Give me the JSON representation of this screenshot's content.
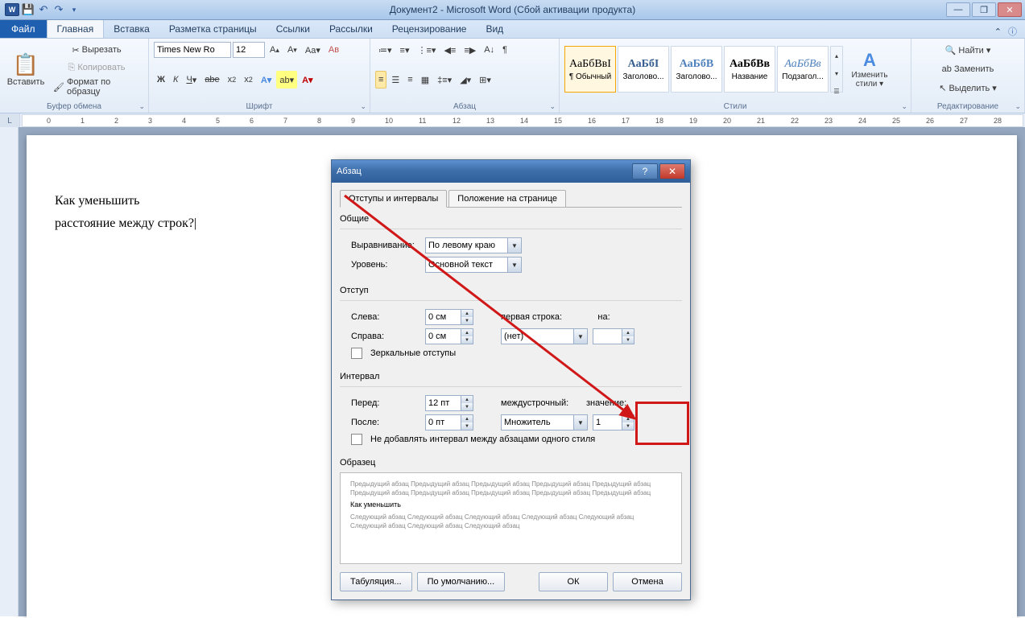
{
  "title": "Документ2 - Microsoft Word (Сбой активации продукта)",
  "tabs": {
    "file": "Файл",
    "home": "Главная",
    "insert": "Вставка",
    "layout": "Разметка страницы",
    "refs": "Ссылки",
    "mail": "Рассылки",
    "review": "Рецензирование",
    "view": "Вид"
  },
  "clipboard": {
    "paste": "Вставить",
    "cut": "Вырезать",
    "copy": "Копировать",
    "painter": "Формат по образцу",
    "label": "Буфер обмена"
  },
  "font": {
    "name": "Times New Ro",
    "size": "12",
    "label": "Шрифт"
  },
  "paragraph": {
    "label": "Абзац"
  },
  "styles": {
    "normal": "¶ Обычный",
    "h1": "Заголово...",
    "h2": "Заголово...",
    "name": "Название",
    "sub": "Подзагол...",
    "prev": "АаБбВвI",
    "prev1": "АаБбІ",
    "prev2": "АаБбВ",
    "prev3": "АаБбВв",
    "prev4": "АаБбВв",
    "change": "Изменить стили ▾",
    "label": "Стили"
  },
  "editing": {
    "find": "Найти ▾",
    "replace": "Заменить",
    "select": "Выделить ▾",
    "label": "Редактирование"
  },
  "doc": {
    "line1": "Как уменьшить",
    "line2": "расстояние между строк?"
  },
  "dialog": {
    "title": "Абзац",
    "tab1": "Отступы и интервалы",
    "tab2": "Положение на странице",
    "sec_general": "Общие",
    "align_label": "Выравнивание:",
    "align_value": "По левому краю",
    "level_label": "Уровень:",
    "level_value": "Основной текст",
    "sec_indent": "Отступ",
    "left_label": "Слева:",
    "left_value": "0 см",
    "right_label": "Справа:",
    "right_value": "0 см",
    "first_line_label": "первая строка:",
    "first_line_value": "(нет)",
    "by_label": "на:",
    "by_value": "",
    "mirror": "Зеркальные отступы",
    "sec_spacing": "Интервал",
    "before_label": "Перед:",
    "before_value": "12 пт",
    "after_label": "После:",
    "after_value": "0 пт",
    "line_spacing_label": "междустрочный:",
    "line_spacing_value": "Множитель",
    "at_label": "значение:",
    "at_value": "1",
    "no_space": "Не добавлять интервал между абзацами одного стиля",
    "sec_preview": "Образец",
    "preview_text": "Предыдущий абзац Предыдущий абзац Предыдущий абзац Предыдущий абзац Предыдущий абзац Предыдущий абзац Предыдущий абзац Предыдущий абзац Предыдущий абзац Предыдущий абзац",
    "preview_sample": "Как уменьшить",
    "preview_text2": "Следующий абзац Следующий абзац Следующий абзац Следующий абзац Следующий абзац Следующий абзац Следующий абзац Следующий абзац",
    "tabs_btn": "Табуляция...",
    "default_btn": "По умолчанию...",
    "ok": "ОК",
    "cancel": "Отмена"
  }
}
